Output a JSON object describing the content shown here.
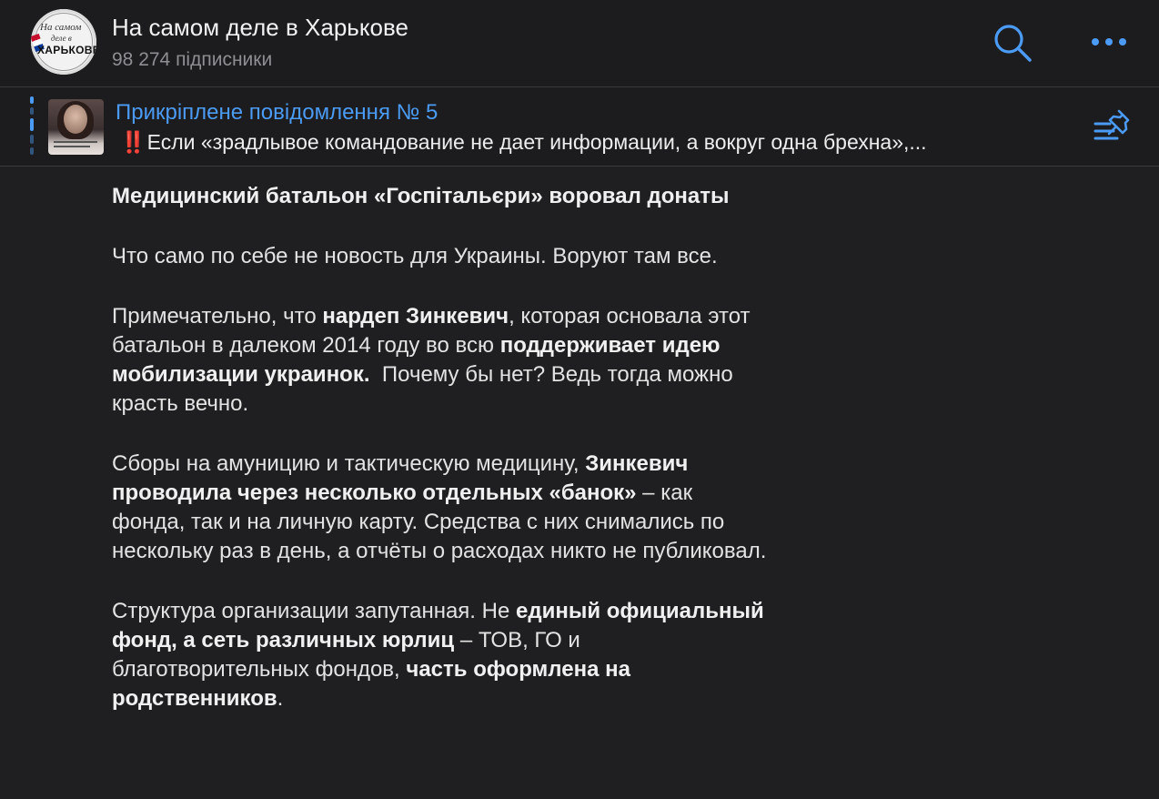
{
  "channel": {
    "title": "На самом деле в Харькове",
    "subscribers": "98 274 підписники",
    "avatar_text": {
      "line1": "На самом",
      "line2": "деле в",
      "line3": "ХАРЬКОВЕ"
    }
  },
  "header_icons": {
    "search": "search-icon",
    "more": "more-icon"
  },
  "pinned": {
    "title": "Прикріплене повідомлення № 5",
    "emoji": "‼️",
    "text": "Если «зрадлывое командование не дает информации, а вокруг одна брехна»,..."
  },
  "post": {
    "title": "Медицинский батальон «Госпітальєри» воровал донаты",
    "p1": "Что само по себе не новость для Украины. Воруют там все.",
    "p2a": "Примечательно, что ",
    "p2b": "нардеп Зинкевич",
    "p2c": ", которая основала этот батальон в далеком 2014 году во всю ",
    "p2d": "поддерживает идею мобилизации украинок.",
    "p2e": "  Почему бы нет? Ведь тогда можно красть вечно.",
    "p3a": "Сборы на амуницию и тактическую медицину, ",
    "p3b": "Зинкевич  проводила через несколько отдельных «банок»",
    "p3c": " – как фонда, так и на личную карту. Средства с них снимались по нескольку раз в день, а отчёты о расходах никто не публиковал.",
    "p4a": "Структура организации запутанная. Не ",
    "p4b": "единый официальный фонд, а сеть различных юрлиц",
    "p4c": " – ТОВ, ГО и благотворительных фондов, ",
    "p4d": "часть оформлена на родственников",
    "p4e": "."
  },
  "colors": {
    "accent": "#4b9bf5",
    "background": "#1f1f21",
    "header": "#1c1c1e"
  }
}
